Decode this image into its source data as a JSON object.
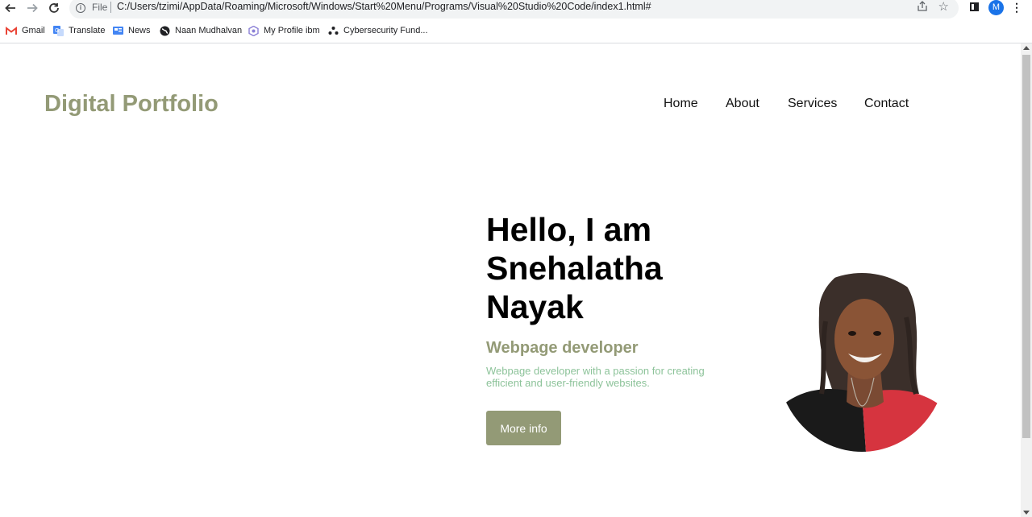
{
  "browser": {
    "address_file": "File",
    "url": "C:/Users/tzimi/AppData/Roaming/Microsoft/Windows/Start%20Menu/Programs/Visual%20Studio%20Code/index1.html#",
    "profile_initial": "M",
    "bookmarks": [
      {
        "label": "Gmail",
        "icon": "gmail-icon"
      },
      {
        "label": "Translate",
        "icon": "translate-icon"
      },
      {
        "label": "News",
        "icon": "news-icon"
      },
      {
        "label": "Naan Mudhalvan",
        "icon": "globe-icon"
      },
      {
        "label": "My Profile ibm",
        "icon": "ibm-icon"
      },
      {
        "label": "Cybersecurity Fund...",
        "icon": "cyber-icon"
      }
    ]
  },
  "site": {
    "logo": "Digital Portfolio",
    "nav": [
      "Home",
      "About",
      "Services",
      "Contact"
    ]
  },
  "hero": {
    "title": "Hello, I am Snehalatha Nayak",
    "subtitle": "Webpage developer",
    "description": "Webpage developer with a passion for creating efficient and user-friendly websites.",
    "button": "More info"
  },
  "colors": {
    "accent": "#939a76",
    "description_text": "#8dc39a",
    "profile_avatar": "#1a73e8"
  }
}
